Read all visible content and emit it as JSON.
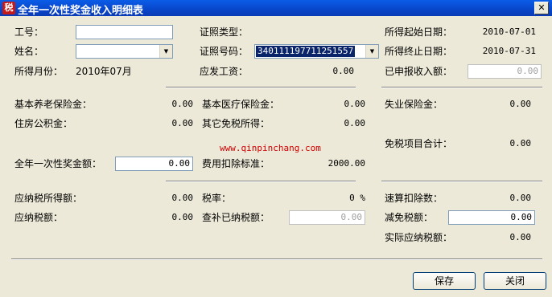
{
  "window": {
    "title": "全年一次性奖金收入明细表",
    "icon_glyph": "税",
    "close_label": "✕"
  },
  "fields": {
    "gonghao_label": "工号：",
    "gonghao_value": "",
    "xingming_label": "姓名：",
    "xingming_value": "",
    "zjlx_label": "证照类型：",
    "zjlx_value": "",
    "zjhm_label": "证照号码：",
    "zjhm_value": "340111197711251557",
    "sdqs_label": "所得起始日期：",
    "sdqs_value": "2010-07-01",
    "sdzz_label": "所得终止日期：",
    "sdzz_value": "2010-07-31",
    "sdyf_label": "所得月份：",
    "sdyf_value": "2010年07月",
    "yfgz_label": "应发工资：",
    "yfgz_value": "0.00",
    "ysb_label": "已申报收入额：",
    "ysb_value": "0.00"
  },
  "insurance": {
    "jbyl_label": "基本养老保险金：",
    "jbyl_value": "0.00",
    "jbyiliao_label": "基本医疗保险金：",
    "jbyiliao_value": "0.00",
    "sybx_label": "失业保险金：",
    "sybx_value": "0.00",
    "zfgjj_label": "住房公积金：",
    "zfgjj_value": "0.00",
    "qtms_label": "其它免税所得：",
    "qtms_value": "0.00",
    "watermark": "www.qinpinchang.com",
    "msxm_label": "免税项目合计：",
    "msxm_value": "0.00",
    "qnycx_label": "全年一次性奖金额：",
    "qnycx_value": "0.00",
    "fykc_label": "费用扣除标准：",
    "fykc_value": "2000.00"
  },
  "tax": {
    "ynssd_label": "应纳税所得额：",
    "ynssd_value": "0.00",
    "sl_label": "税率：",
    "sl_value": "0 %",
    "sskcs_label": "速算扣除数：",
    "sskcs_value": "0.00",
    "ynse_label": "应纳税额：",
    "ynse_value": "0.00",
    "cbyn_label": "查补已纳税额：",
    "cbyn_value": "0.00",
    "jmse_label": "减免税额：",
    "jmse_value": "0.00",
    "sjyn_label": "实际应纳税额：",
    "sjyn_value": "0.00"
  },
  "buttons": {
    "save": "保存",
    "close": "关闭"
  }
}
